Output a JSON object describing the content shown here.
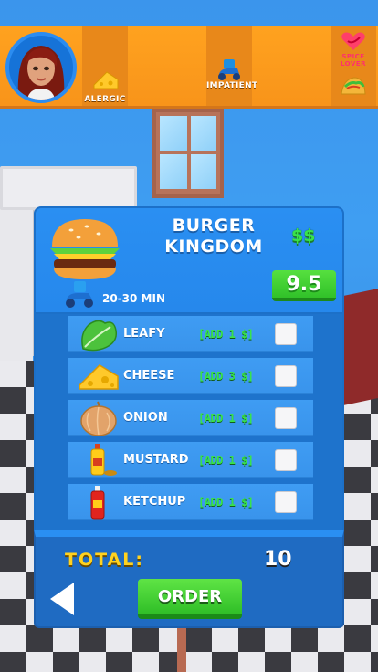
{
  "customer": {
    "traits": [
      {
        "label": "ALERGIC",
        "icon": "cheese-icon"
      },
      {
        "label": "IMPATIENT",
        "icon": "scooter-icon"
      },
      {
        "label": "SPICE LOVER",
        "icon": "taco-icon"
      }
    ],
    "spice_label_line1": "SPICE",
    "spice_label_line2": "LOVER"
  },
  "restaurant": {
    "name": "BURGER KINGDOM",
    "price_level": "$$",
    "rating": "9.5",
    "delivery_time": "20-30 MIN"
  },
  "options": [
    {
      "name": "LEAFY",
      "price": "[ADD 1 $]",
      "icon": "lettuce-icon",
      "checked": false
    },
    {
      "name": "CHEESE",
      "price": "[ADD 3 $]",
      "icon": "cheese-icon",
      "checked": false
    },
    {
      "name": "ONION",
      "price": "[ADD 1 $]",
      "icon": "onion-icon",
      "checked": false
    },
    {
      "name": "MUSTARD",
      "price": "[ADD 1 $]",
      "icon": "mustard-icon",
      "checked": false
    },
    {
      "name": "KETCHUP",
      "price": "[ADD 1 $]",
      "icon": "ketchup-icon",
      "checked": false
    }
  ],
  "footer": {
    "total_label": "TOTAL:",
    "total_value": "10",
    "order_label": "ORDER"
  },
  "colors": {
    "accent_orange": "#f8941a",
    "panel_blue": "#2a8ff2",
    "money_green": "#39e34a",
    "total_yellow": "#ffd21f"
  }
}
